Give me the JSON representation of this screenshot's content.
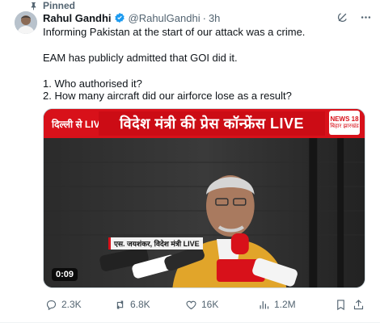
{
  "pinned_label": "Pinned",
  "author": {
    "name": "Rahul Gandhi",
    "handle": "@RahulGandhi",
    "separator": "·",
    "time": "3h"
  },
  "body": {
    "line1": "Informing Pakistan at the start of our attack was a crime.",
    "line2": "EAM has publicly admitted that GOI did it.",
    "line3": "1. Who authorised it?",
    "line4": "2. How many aircraft did our airforce lose as a result?"
  },
  "media": {
    "banner_left": "दिल्ली से LIVE",
    "banner_title": "विदेश मंत्री की प्रेस कॉन्फ्रेंस LIVE",
    "logo_line1": "NEWS 18",
    "logo_line2": "बिहार झारखंड",
    "caption": "एस. जयशंकर, विदेश मंत्री LIVE",
    "duration": "0:09"
  },
  "actions": {
    "replies": "2.3K",
    "reposts": "6.8K",
    "likes": "16K",
    "views": "1.2M"
  },
  "icons": {
    "pin": "pin-icon",
    "verified": "verified-badge-icon",
    "grok": "grok-icon",
    "more": "more-icon",
    "reply": "reply-icon",
    "repost": "repost-icon",
    "like": "heart-icon",
    "views": "views-icon",
    "bookmark": "bookmark-icon",
    "share": "share-icon"
  },
  "colors": {
    "text": "#0f1419",
    "secondary": "#536471",
    "verified": "#1d9bf0",
    "banner_red": "#d8111a"
  }
}
